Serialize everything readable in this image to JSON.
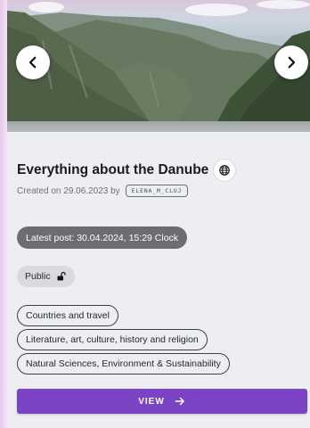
{
  "card": {
    "title": "Everything about the Danube",
    "created_prefix": "Created on 29.06.2023 by",
    "author": "ELENA_M_CLUJ",
    "latest_post": "Latest post: 30.04.2024, 15:29 Clock",
    "visibility": "Public",
    "tags": [
      "Countries and travel",
      "Literature, art, culture, history and religion",
      "Natural Sciences, Environment & Sustainability"
    ],
    "view_label": "VIEW"
  },
  "icons": {
    "prev": "chevron-left-icon",
    "next": "chevron-right-icon",
    "globe": "globe-icon",
    "lock": "unlock-icon",
    "arrow": "arrow-right-icon"
  },
  "colors": {
    "accent": "#7a44c4",
    "latest_chip": "#6b6d72",
    "public_chip": "#d8dade",
    "card_bg": "#eceef1"
  }
}
